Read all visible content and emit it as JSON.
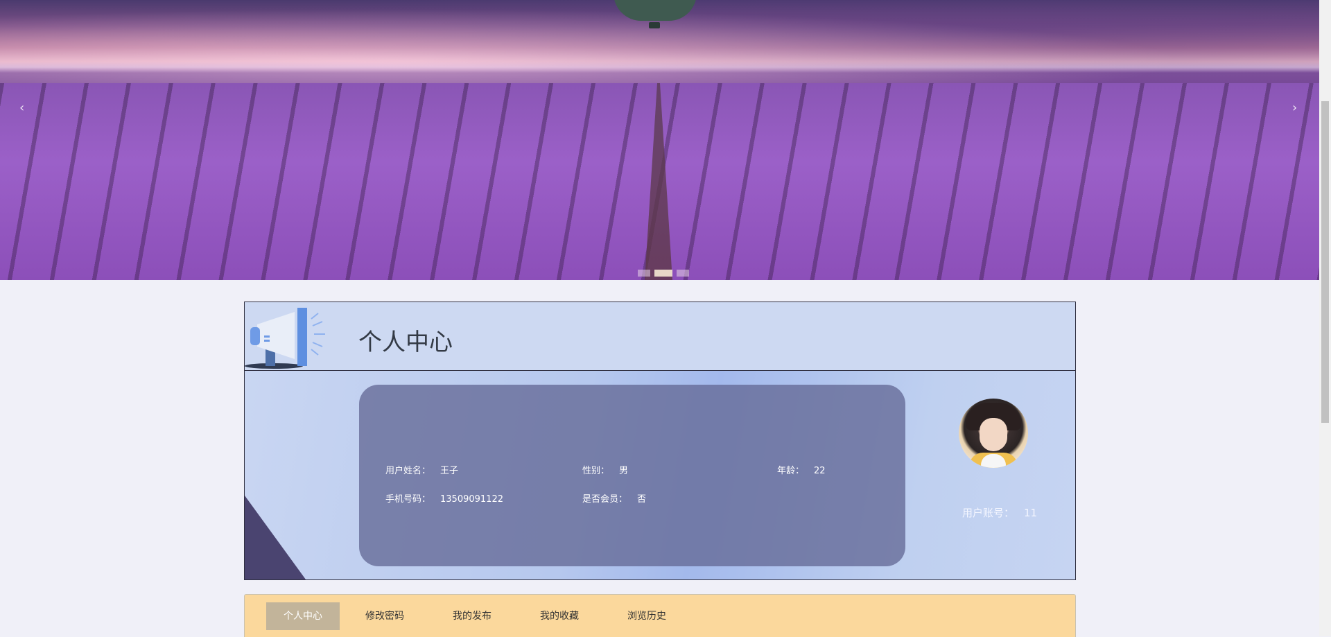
{
  "carousel": {
    "prev_icon": "‹",
    "next_icon": "›",
    "slides": 3,
    "active_slide": 2
  },
  "profile": {
    "title": "个人中心",
    "fields": {
      "name_label": "用户姓名：",
      "name_value": "王子",
      "gender_label": "性别：",
      "gender_value": "男",
      "age_label": "年龄：",
      "age_value": "22",
      "phone_label": "手机号码：",
      "phone_value": "13509091122",
      "member_label": "是否会员：",
      "member_value": "否"
    },
    "account_label": "用户账号：",
    "account_value": "11"
  },
  "tabs": [
    {
      "label": "个人中心",
      "active": true
    },
    {
      "label": "修改密码",
      "active": false
    },
    {
      "label": "我的发布",
      "active": false
    },
    {
      "label": "我的收藏",
      "active": false
    },
    {
      "label": "浏览历史",
      "active": false
    }
  ],
  "colors": {
    "accent_header": "#cdd9f2",
    "tab_bar": "#fbd89c",
    "tab_active": "#c2b49a",
    "info_panel": "#6a6f98"
  }
}
